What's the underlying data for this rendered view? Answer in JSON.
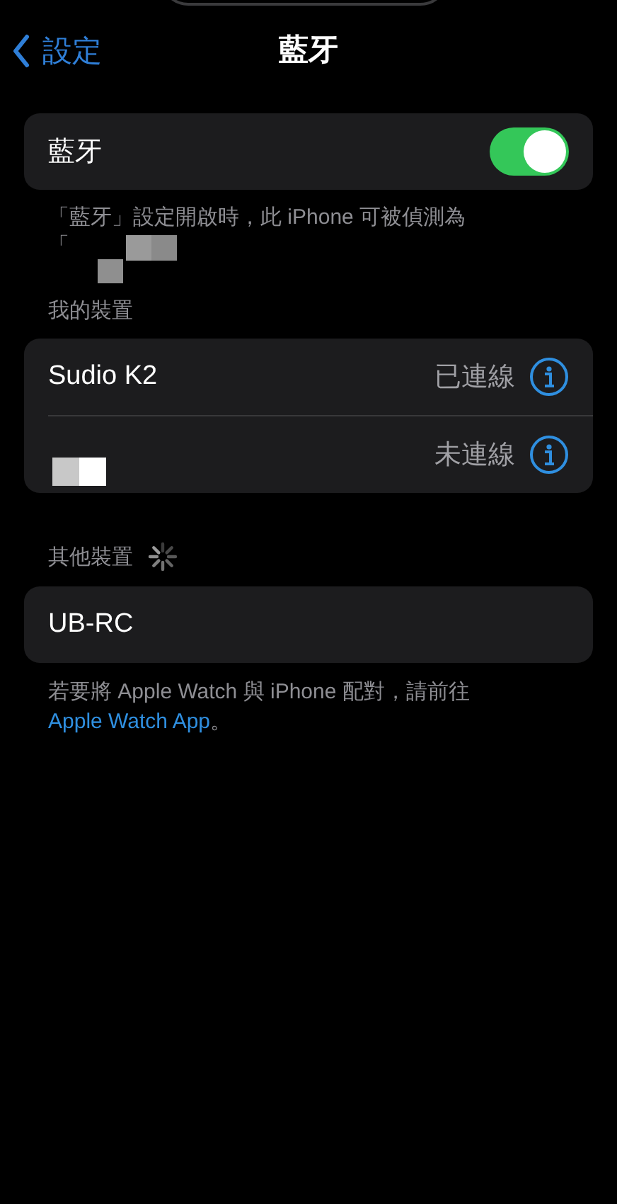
{
  "nav": {
    "back_label": "設定",
    "title": "藍牙"
  },
  "bluetooth": {
    "label": "藍牙",
    "on": true
  },
  "bluetooth_footer": {
    "text": "「藍牙」設定開啟時，此 iPhone 可被偵測為",
    "second_line": "「",
    "redacted": true
  },
  "my_devices": {
    "header": "我的裝置",
    "devices": [
      {
        "kind": "named",
        "name": "Sudio K2",
        "status": "已連線"
      },
      {
        "kind": "redacted",
        "status": "未連線"
      }
    ]
  },
  "other_devices": {
    "header": "其他裝置",
    "searching": true,
    "devices": [
      {
        "name": "UB-RC"
      }
    ]
  },
  "watch_footer": {
    "text": "若要將 Apple Watch 與 iPhone 配對，請前往",
    "link": "Apple Watch App",
    "end": "。"
  }
}
